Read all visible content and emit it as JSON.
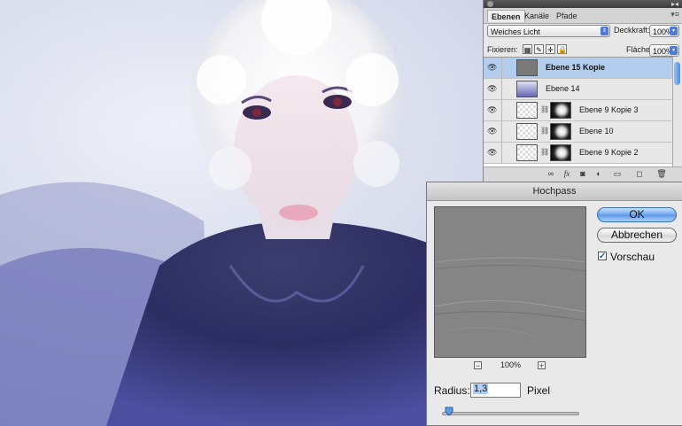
{
  "layers_panel": {
    "tabs": [
      {
        "label": "Ebenen",
        "active": true
      },
      {
        "label": "Kanäle",
        "active": false
      },
      {
        "label": "Pfade",
        "active": false
      }
    ],
    "blend_mode": "Weiches Licht",
    "opacity_label": "Deckkraft:",
    "opacity_value": "100%",
    "lock_label": "Fixieren:",
    "fill_label": "Fläche:",
    "fill_value": "100%",
    "layers": [
      {
        "name": "Ebene 15 Kopie",
        "selected": true,
        "visible": true,
        "has_mask": false,
        "thumb": "gray"
      },
      {
        "name": "Ebene 14",
        "selected": false,
        "visible": true,
        "has_mask": false,
        "thumb": "photo"
      },
      {
        "name": "Ebene 9 Kopie 3",
        "selected": false,
        "visible": true,
        "has_mask": true,
        "thumb": "transparent"
      },
      {
        "name": "Ebene 10",
        "selected": false,
        "visible": true,
        "has_mask": true,
        "thumb": "transparent"
      },
      {
        "name": "Ebene 9 Kopie 2",
        "selected": false,
        "visible": true,
        "has_mask": true,
        "thumb": "transparent"
      }
    ],
    "footer_icons": [
      "link-icon",
      "fx-icon",
      "mask-icon",
      "adjustment-icon",
      "folder-icon",
      "new-layer-icon",
      "trash-icon"
    ]
  },
  "dialog": {
    "title": "Hochpass",
    "ok_label": "OK",
    "cancel_label": "Abbrechen",
    "preview_label": "Vorschau",
    "preview_checked": true,
    "zoom_value": "100%",
    "zoom_out": "−",
    "zoom_in": "+",
    "radius_label": "Radius:",
    "radius_value": "1,3",
    "unit_label": "Pixel",
    "slider_level": 0.05
  },
  "colors": {
    "accent": "#5d99e7",
    "selected_layer": "#b3cdee",
    "preview_gray": "#858585"
  }
}
